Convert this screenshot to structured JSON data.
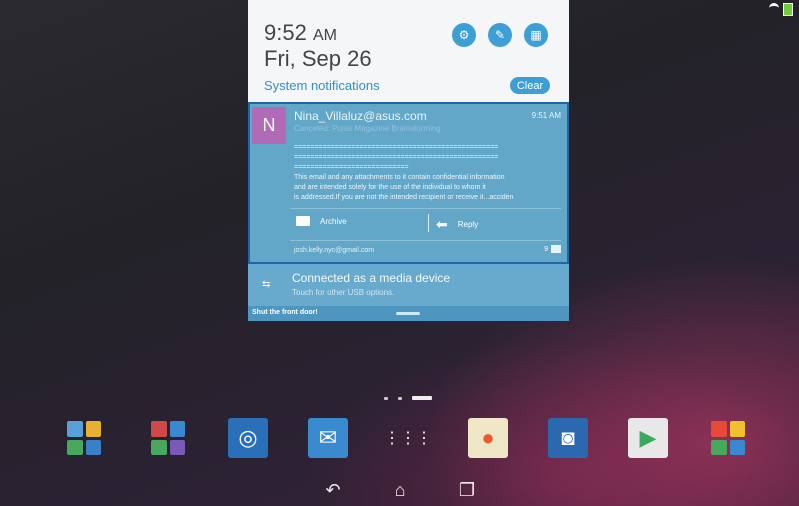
{
  "shade": {
    "time": "9:52",
    "ampm": "AM",
    "date": "Fri, Sep 26",
    "section_label": "System notifications",
    "clear_label": "Clear",
    "quick_buttons": [
      "settings-icon",
      "edit-icon",
      "grid-icon"
    ]
  },
  "email": {
    "avatar_letter": "N",
    "sender": "Nina_Villaluz@asus.com",
    "time": "9:51 AM",
    "subject": "Canceled: Poise Magazine Brainstorming",
    "body_lines": [
      "==================================================",
      "==================================================",
      "============================",
      "This email and any attachments to it contain confidential information",
      "and are intended solely for the use of the individual to whom it",
      "is addressed.If you are not the intended recipient or receive it...acciden"
    ],
    "archive_label": "Archive",
    "reply_label": "Reply",
    "account": "josh.kelly.nyc@gmail.com",
    "count": "9"
  },
  "usb": {
    "title": "Connected as a media device",
    "subtitle": "Touch for other USB options."
  },
  "footer": {
    "text": "Shut the front door!"
  },
  "colors": {
    "accent": "#3d9fd6",
    "card": "#62a6c8",
    "card_border": "#1f66a8"
  }
}
